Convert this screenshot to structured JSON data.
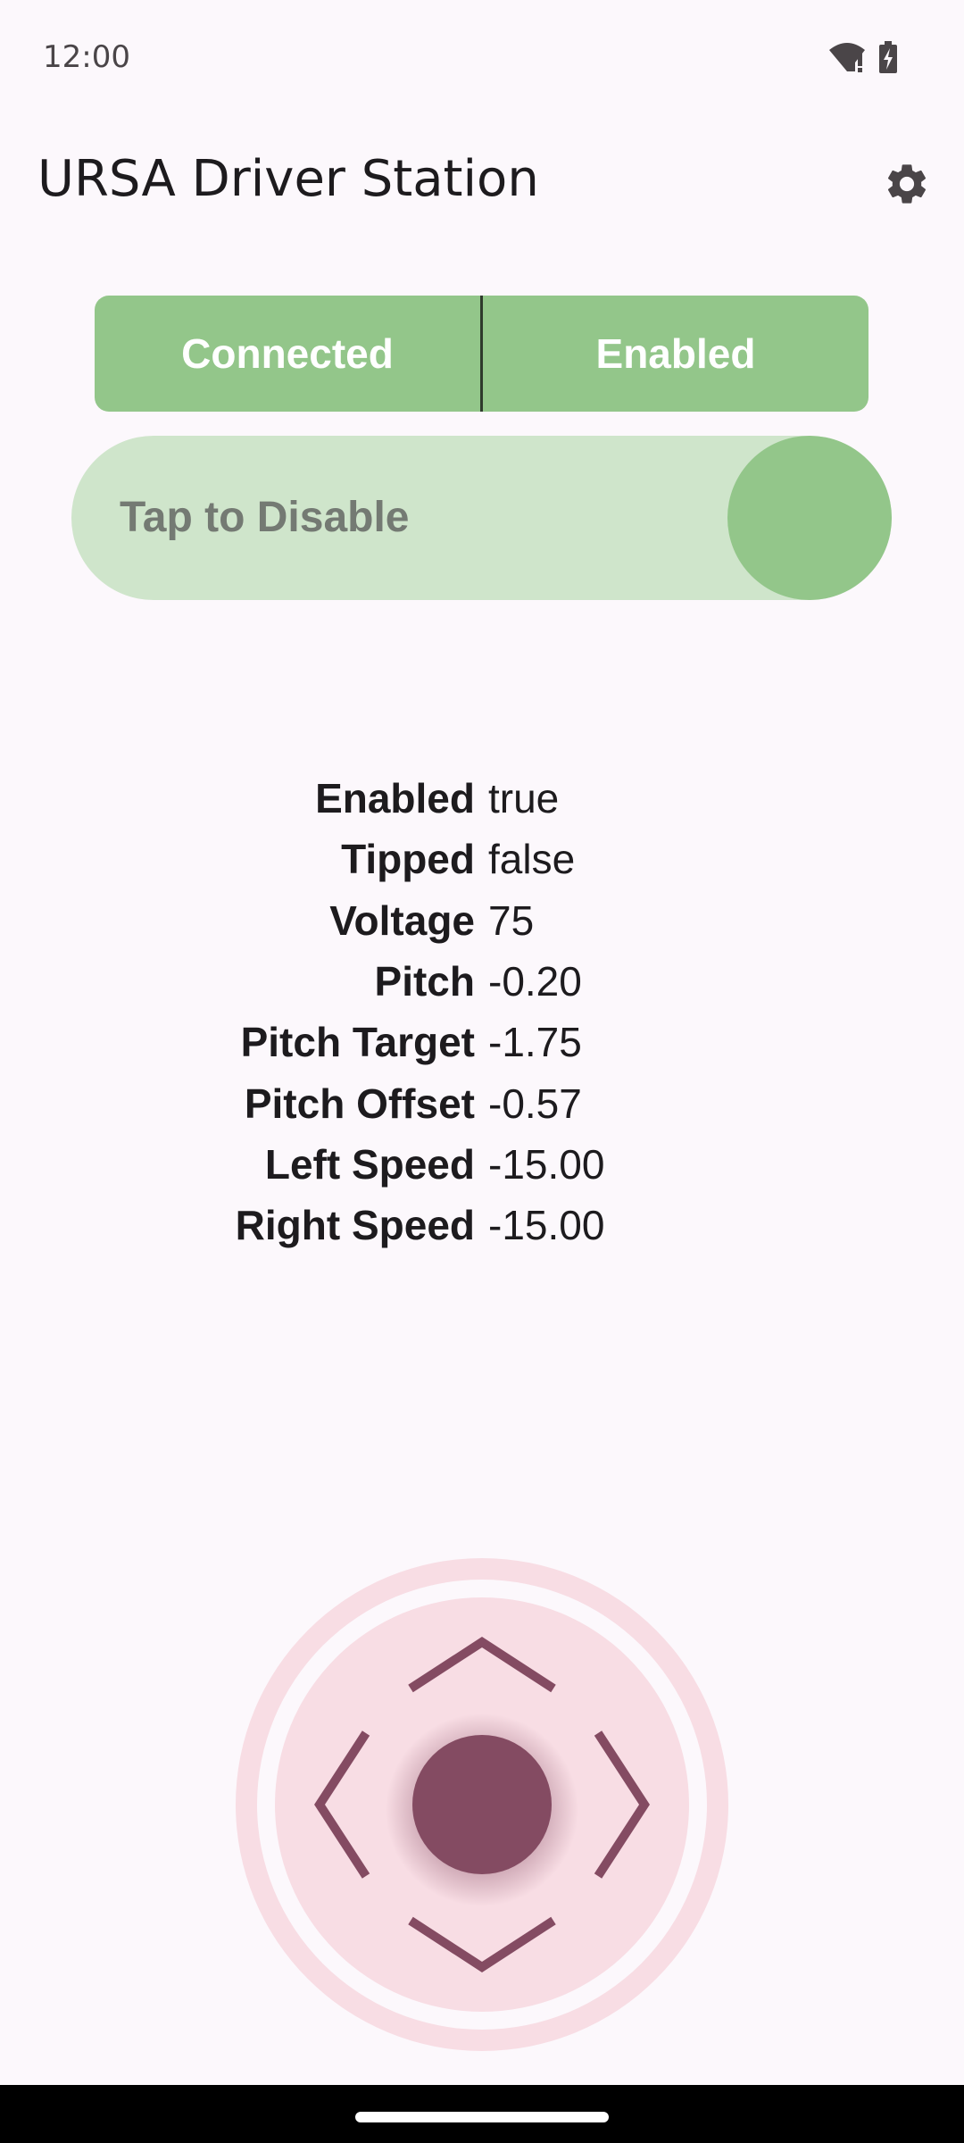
{
  "status_bar": {
    "time": "12:00",
    "icons": [
      "wifi-alert-icon",
      "battery-charging-icon"
    ]
  },
  "app_bar": {
    "title": "URSA Driver Station",
    "settings_icon": "gear-icon"
  },
  "status": {
    "connection": "Connected",
    "robot_state": "Enabled",
    "color": "#93c68a"
  },
  "toggle": {
    "label": "Tap to Disable",
    "track_color": "#cfe5cb",
    "knob_color": "#93c68a"
  },
  "telemetry": [
    {
      "key": "Enabled",
      "value": "true"
    },
    {
      "key": "Tipped",
      "value": "false"
    },
    {
      "key": "Voltage",
      "value": "75"
    },
    {
      "key": "Pitch",
      "value": "-0.20"
    },
    {
      "key": "Pitch Target",
      "value": "-1.75"
    },
    {
      "key": "Pitch Offset",
      "value": "-0.57"
    },
    {
      "key": "Left Speed",
      "value": "-15.00"
    },
    {
      "key": "Right Speed",
      "value": "-15.00"
    }
  ],
  "joystick": {
    "ring_color": "#f8dde4",
    "thumb_color": "#844b62",
    "icons": [
      "chevron-up-icon",
      "chevron-down-icon",
      "chevron-left-icon",
      "chevron-right-icon"
    ]
  }
}
